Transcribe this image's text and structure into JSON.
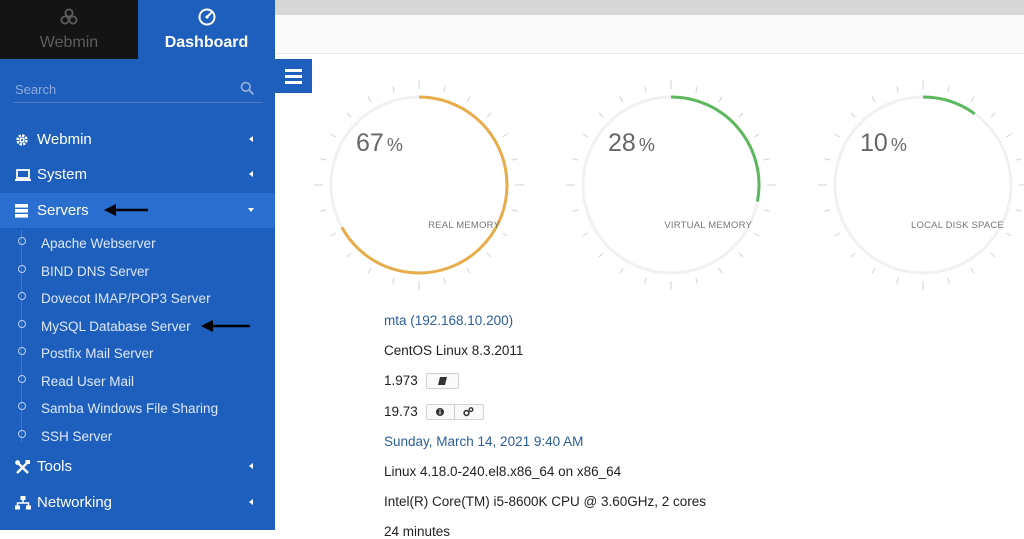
{
  "sidebar": {
    "switch": {
      "webmin_label": "Webmin",
      "dashboard_label": "Dashboard"
    },
    "search_placeholder": "Search",
    "nav": [
      {
        "label": "Webmin",
        "icon": "gear-icon"
      },
      {
        "label": "System",
        "icon": "laptop-icon"
      },
      {
        "label": "Servers",
        "icon": "server-stack-icon"
      },
      {
        "label": "Tools",
        "icon": "tools-icon"
      },
      {
        "label": "Networking",
        "icon": "network-icon"
      }
    ],
    "servers_items": [
      "Apache Webserver",
      "BIND DNS Server",
      "Dovecot IMAP/POP3 Server",
      "MySQL Database Server",
      "Postfix Mail Server",
      "Read User Mail",
      "Samba Windows File Sharing",
      "SSH Server"
    ]
  },
  "gauges": [
    {
      "value": "67",
      "fraction": 0.67,
      "unit": "%",
      "label": "REAL MEMORY",
      "color": "#e8ad4b"
    },
    {
      "value": "28",
      "fraction": 0.28,
      "unit": "%",
      "label": "VIRTUAL MEMORY",
      "color": "#5cb85c"
    },
    {
      "value": "10",
      "fraction": 0.1,
      "unit": "%",
      "label": "LOCAL DISK SPACE",
      "color": "#5cb85c"
    }
  ],
  "system_info": {
    "host": "mta (192.168.10.200)",
    "os": "CentOS Linux 8.3.2011",
    "webmin_version": "1.973",
    "theme_version": "19.73",
    "time": "Sunday, March 14, 2021 9:40 AM",
    "kernel": "Linux 4.18.0-240.el8.x86_64 on x86_64",
    "cpu": "Intel(R) Core(TM) i5-8600K CPU @ 3.60GHz, 2 cores",
    "uptime": "24 minutes"
  },
  "colors": {
    "sidebar": "#1e5fbe",
    "accent_link": "#2c5d9c"
  }
}
